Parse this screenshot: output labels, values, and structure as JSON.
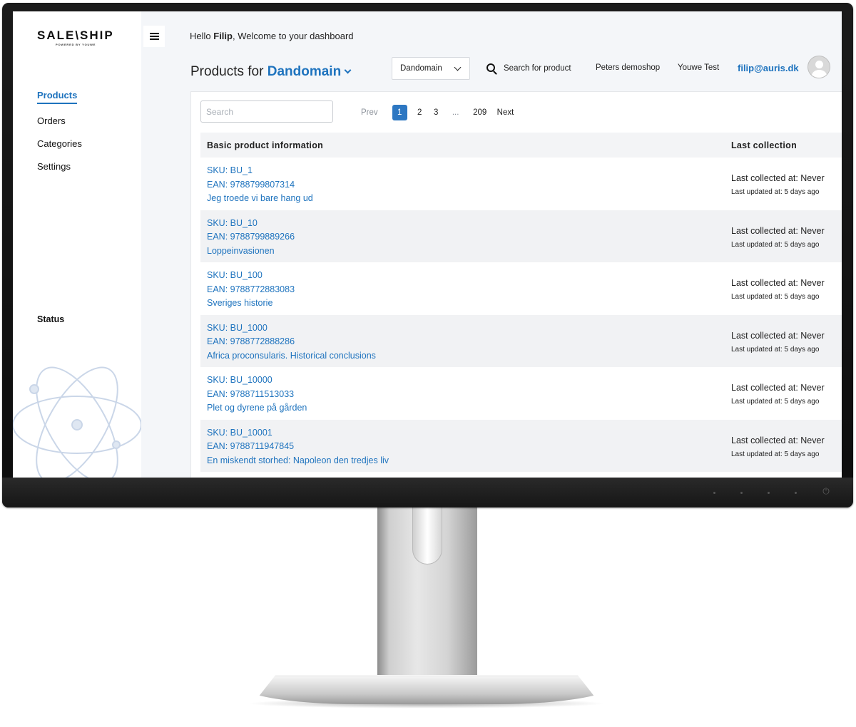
{
  "app": {
    "logo": "SALE\\SHIP",
    "logo_tagline": "POWERED BY YOUWE"
  },
  "sidebar": {
    "items": [
      {
        "label": "Products"
      },
      {
        "label": "Orders"
      },
      {
        "label": "Categories"
      },
      {
        "label": "Settings"
      }
    ],
    "status_label": "Status"
  },
  "header": {
    "greeting_prefix": "Hello ",
    "user_first_name": "Filip",
    "greeting_suffix": ", Welcome to your dashboard",
    "title_prefix": "Products for ",
    "title_shop": "Dandomain",
    "shop_select": "Dandomain",
    "search_product": "Search for product",
    "links": [
      "Peters demoshop",
      "Youwe Test"
    ],
    "user_email": "filip@auris.dk"
  },
  "search": {
    "placeholder": "Search"
  },
  "pagination": {
    "prev": "Prev",
    "pages": [
      "1",
      "2",
      "3"
    ],
    "ellipsis": "...",
    "last": "209",
    "next": "Next"
  },
  "table": {
    "columns": [
      "Basic product information",
      "Last collection"
    ],
    "rows": [
      {
        "sku": "SKU: BU_1",
        "ean": "EAN: 9788799807314",
        "name": "Jeg troede vi bare hang ud",
        "collected": "Last collected at: Never",
        "updated": "Last updated at: 5 days ago"
      },
      {
        "sku": "SKU: BU_10",
        "ean": "EAN: 9788799889266",
        "name": "Loppeinvasionen",
        "collected": "Last collected at: Never",
        "updated": "Last updated at: 5 days ago"
      },
      {
        "sku": "SKU: BU_100",
        "ean": "EAN: 9788772883083",
        "name": "Sveriges historie",
        "collected": "Last collected at: Never",
        "updated": "Last updated at: 5 days ago"
      },
      {
        "sku": "SKU: BU_1000",
        "ean": "EAN: 9788772888286",
        "name": "Africa proconsularis. Historical conclusions",
        "collected": "Last collected at: Never",
        "updated": "Last updated at: 5 days ago"
      },
      {
        "sku": "SKU: BU_10000",
        "ean": "EAN: 9788711513033",
        "name": "Plet og dyrene på gården",
        "collected": "Last collected at: Never",
        "updated": "Last updated at: 5 days ago"
      },
      {
        "sku": "SKU: BU_10001",
        "ean": "EAN: 9788711947845",
        "name": "En miskendt storhed: Napoleon den tredjes liv",
        "collected": "Last collected at: Never",
        "updated": "Last updated at: 5 days ago"
      }
    ]
  },
  "colors": {
    "accent": "#1e73be",
    "page_active": "#2d77c2"
  },
  "icons": [
    "menu-icon",
    "chevron-down-icon",
    "search-icon",
    "avatar-icon",
    "power-icon"
  ]
}
